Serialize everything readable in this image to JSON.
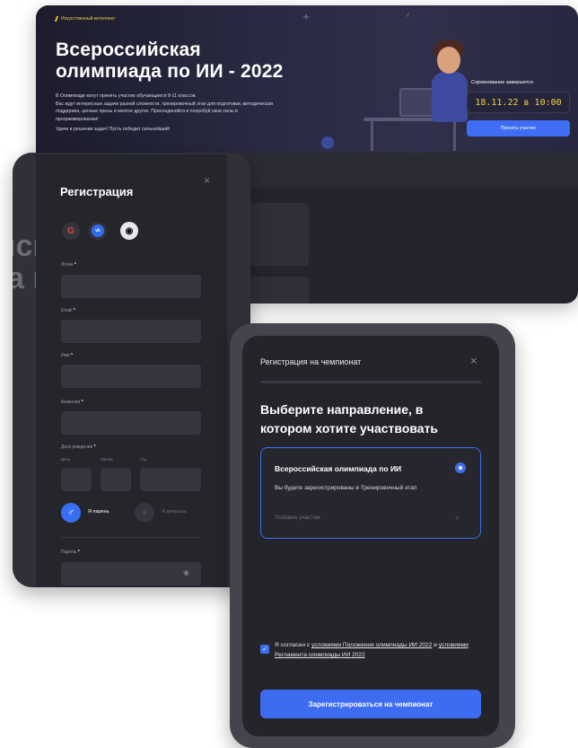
{
  "banner": {
    "breadcrumb": "Искусственный интеллект",
    "title_line1": "Всероссийская",
    "title_line2": "олимпиада по ИИ - 2022",
    "description": [
      "В Олимпиаде могут принять участие обучающиеся 8-11 классов.",
      "Вас ждут интересные задачи разной сложности, тренировочный этап для подготовки, методическая",
      "поддержка, ценные призы и многое другое. Присоединяйся и попробуй свои силы в",
      "программировании!"
    ],
    "wish": "Удачи в решении задач! Пусть победит сильнейший!",
    "countdown_label": "Соревнование завершится",
    "countdown_value": "18.11.22 в 10:00",
    "join_button": "Принять участие"
  },
  "background_ghost_text": {
    "line1": "ıсı",
    "line2": "a ı"
  },
  "registration": {
    "title": "Регистрация",
    "close": "×",
    "social": {
      "google": "G",
      "vk": "vk",
      "github": "◉"
    },
    "login_label": "Логин",
    "email_label": "Email",
    "first_name_label": "Имя",
    "last_name_label": "Фамилия",
    "birthdate_label": "Дата рождения",
    "required_mark": "*",
    "day_label": "День",
    "month_label": "Месяц",
    "year_label": "Год",
    "male_label": "Я парень",
    "female_label": "Я девушка",
    "password_label": "Пароль"
  },
  "championship": {
    "header": "Регистрация на чемпионат",
    "close": "×",
    "question": "Выберите направление, в котором хотите участвовать",
    "option": {
      "title": "Всероссийская олимпиада по ИИ",
      "description": "Вы будете зарегистрированы в Тренировочный этап",
      "link": "Условия участия",
      "selected": true
    },
    "agreement": {
      "prefix": "Я согласен с ",
      "link1": "условиями Положения олимпиады ИИ 2022",
      "middle": " и ",
      "link2": "условиями Регламента олимпиады ИИ 2022",
      "checked": true
    },
    "submit_button": "Зарегистрироваться на чемпионат"
  },
  "colors": {
    "accent": "#3e6cf0",
    "countdown_text": "#f2d23c",
    "modal_bg": "#24252b"
  }
}
